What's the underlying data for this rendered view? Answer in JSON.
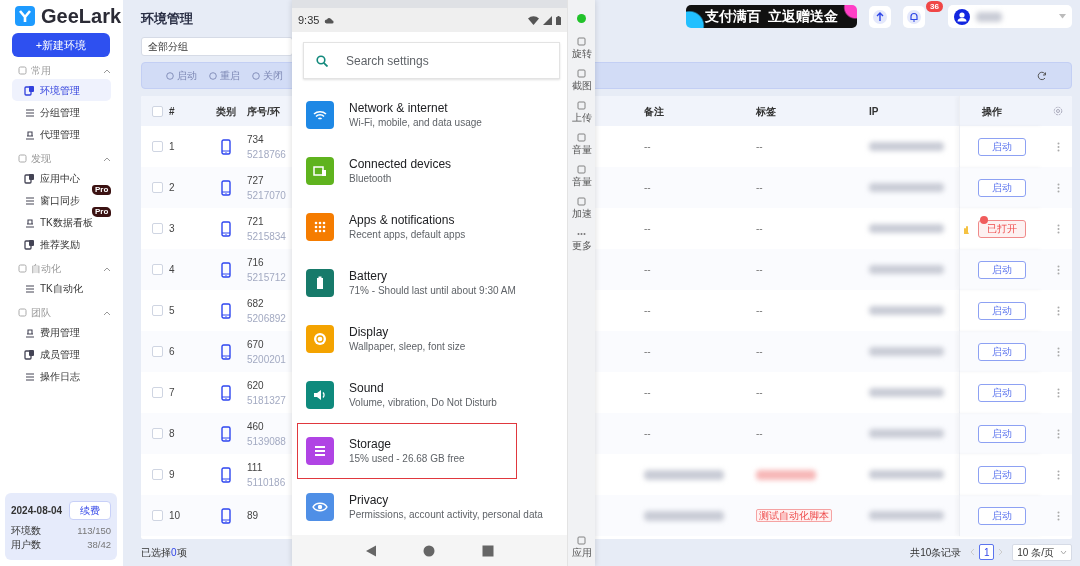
{
  "app": {
    "logo_text": "GeeLark",
    "new_button": "+新建环境"
  },
  "sidebar": {
    "sections": [
      {
        "title": "常用",
        "expanded": true,
        "items": [
          {
            "label": "环境管理",
            "selected": true
          },
          {
            "label": "分组管理",
            "selected": false
          },
          {
            "label": "代理管理",
            "selected": false
          }
        ]
      },
      {
        "title": "发现",
        "expanded": true,
        "items": [
          {
            "label": "应用中心",
            "selected": false
          },
          {
            "label": "窗口同步",
            "selected": false,
            "badge": "Pro"
          },
          {
            "label": "TK数据看板",
            "selected": false,
            "badge": "Pro"
          },
          {
            "label": "推荐奖励",
            "selected": false
          }
        ]
      },
      {
        "title": "自动化",
        "expanded": true,
        "items": [
          {
            "label": "TK自动化",
            "selected": false
          }
        ]
      },
      {
        "title": "团队",
        "expanded": true,
        "items": [
          {
            "label": "费用管理",
            "selected": false
          },
          {
            "label": "成员管理",
            "selected": false
          },
          {
            "label": "操作日志",
            "selected": false
          }
        ]
      }
    ]
  },
  "plan": {
    "date": "2024-08-04",
    "renew_button": "续费",
    "stats": [
      {
        "label": "环境数",
        "value": "113/150"
      },
      {
        "label": "用户数",
        "value": "38/42"
      }
    ]
  },
  "header": {
    "title": "环境管理",
    "banner": "支付满百  立返赠送金",
    "notifications_count": "36"
  },
  "group_filter": {
    "value": "全部分组"
  },
  "toolbar": {
    "actions": [
      {
        "label": "启动",
        "disabled": true
      },
      {
        "label": "重启",
        "disabled": true
      },
      {
        "label": "关闭",
        "disabled": true
      }
    ]
  },
  "table": {
    "select_all": {
      "checked": false
    },
    "columns": [
      "#",
      "类别",
      "序号/环",
      "备注",
      "标签",
      "IP",
      "操作"
    ],
    "rows": [
      {
        "index": "1",
        "checked": false,
        "number": "734",
        "serial": "5218766",
        "note": {
          "kind": "text",
          "text": "--"
        },
        "tag": {
          "kind": "text",
          "text": "--"
        },
        "action": {
          "label": "启动",
          "opened": false
        }
      },
      {
        "index": "2",
        "checked": false,
        "number": "727",
        "serial": "5217070",
        "note": {
          "kind": "text",
          "text": "--"
        },
        "tag": {
          "kind": "text",
          "text": "--"
        },
        "action": {
          "label": "启动",
          "opened": false
        }
      },
      {
        "index": "3",
        "checked": false,
        "number": "721",
        "serial": "5215834",
        "note": {
          "kind": "text",
          "text": "--"
        },
        "tag": {
          "kind": "text",
          "text": "--"
        },
        "action": {
          "label": "已打开",
          "opened": true
        }
      },
      {
        "index": "4",
        "checked": false,
        "number": "716",
        "serial": "5215712",
        "note": {
          "kind": "text",
          "text": "--"
        },
        "tag": {
          "kind": "text",
          "text": "--"
        },
        "action": {
          "label": "启动",
          "opened": false
        }
      },
      {
        "index": "5",
        "checked": false,
        "number": "682",
        "serial": "5206892",
        "note": {
          "kind": "text",
          "text": "--"
        },
        "tag": {
          "kind": "text",
          "text": "--"
        },
        "action": {
          "label": "启动",
          "opened": false
        }
      },
      {
        "index": "6",
        "checked": false,
        "number": "670",
        "serial": "5200201",
        "note": {
          "kind": "text",
          "text": "--"
        },
        "tag": {
          "kind": "text",
          "text": "--"
        },
        "action": {
          "label": "启动",
          "opened": false
        }
      },
      {
        "index": "7",
        "checked": false,
        "number": "620",
        "serial": "5181327",
        "note": {
          "kind": "text",
          "text": "--"
        },
        "tag": {
          "kind": "text",
          "text": "--"
        },
        "action": {
          "label": "启动",
          "opened": false
        }
      },
      {
        "index": "8",
        "checked": false,
        "number": "460",
        "serial": "5139088",
        "note": {
          "kind": "text",
          "text": "--"
        },
        "tag": {
          "kind": "text",
          "text": "--"
        },
        "action": {
          "label": "启动",
          "opened": false
        }
      },
      {
        "index": "9",
        "checked": false,
        "number": "111",
        "serial": "5110186",
        "note": {
          "kind": "blurred"
        },
        "tag": {
          "kind": "blurred"
        },
        "action": {
          "label": "启动",
          "opened": false
        }
      },
      {
        "index": "10",
        "checked": false,
        "number": "89",
        "note": {
          "kind": "blurred"
        },
        "tag": {
          "kind": "tag",
          "text": "测试自动化脚本"
        },
        "action": {
          "label": "启动",
          "opened": false
        }
      }
    ]
  },
  "footer": {
    "selection": {
      "before": "已选择",
      "count": "0",
      "after": "项"
    },
    "total": "共10条记录",
    "pages": [
      {
        "label": "1",
        "selected": true
      }
    ],
    "page_size": "10 条/页"
  },
  "phone": {
    "time": "9:35",
    "online": true,
    "search_placeholder": "Search settings",
    "settings": [
      {
        "title": "Network & internet",
        "subtitle": "Wi-Fi, mobile, and data usage",
        "color": "#1e88e5",
        "highlighted": false
      },
      {
        "title": "Connected devices",
        "subtitle": "Bluetooth",
        "color": "#5fb31e",
        "highlighted": false
      },
      {
        "title": "Apps & notifications",
        "subtitle": "Recent apps, default apps",
        "color": "#f57c00",
        "highlighted": false
      },
      {
        "title": "Battery",
        "subtitle": "71% - Should last until about 9:30 AM",
        "color": "#177a6a",
        "highlighted": false
      },
      {
        "title": "Display",
        "subtitle": "Wallpaper, sleep, font size",
        "color": "#f4a300",
        "highlighted": false
      },
      {
        "title": "Sound",
        "subtitle": "Volume, vibration, Do Not Disturb",
        "color": "#0f8a7d",
        "highlighted": false
      },
      {
        "title": "Storage",
        "subtitle": "15% used - 26.68 GB free",
        "color": "#b044e4",
        "highlighted": true
      },
      {
        "title": "Privacy",
        "subtitle": "Permissions, account activity, personal data",
        "color": "#4f8fe6",
        "highlighted": false
      }
    ],
    "tools": [
      {
        "label": "旋转"
      },
      {
        "label": "截图"
      },
      {
        "label": "上传"
      },
      {
        "label": "音量"
      },
      {
        "label": "音量"
      },
      {
        "label": "加速"
      },
      {
        "label": "更多"
      }
    ],
    "apps_label": "应用"
  }
}
